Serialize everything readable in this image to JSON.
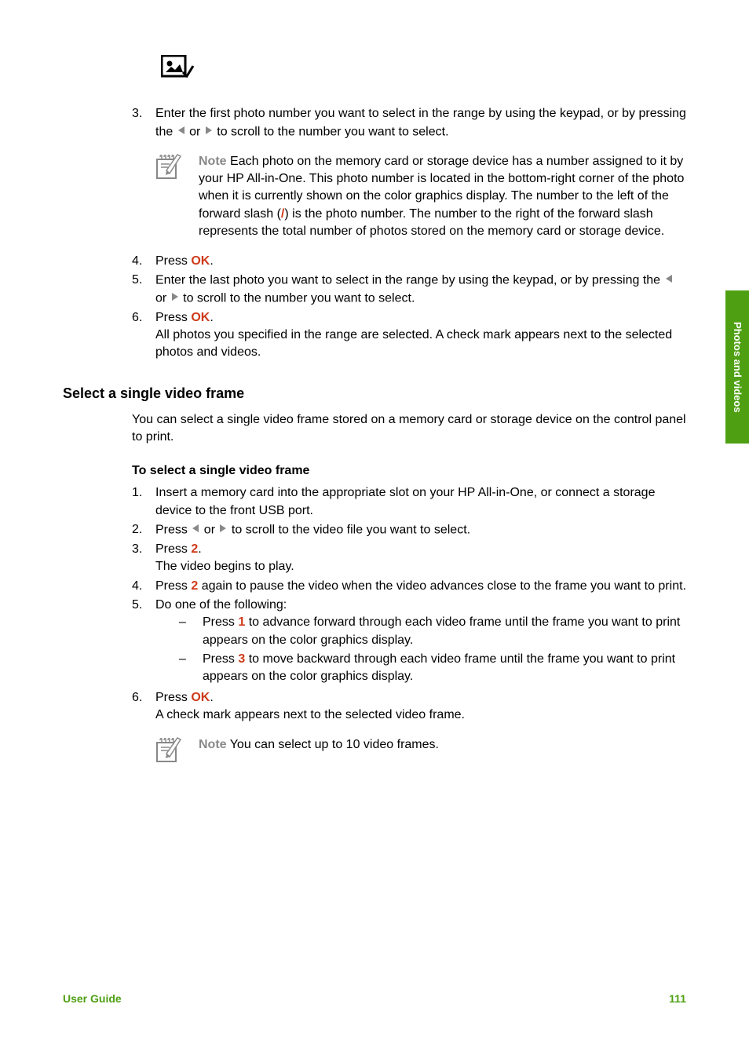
{
  "sideTab": "Photos and videos",
  "step3": {
    "num": "3.",
    "textA": "Enter the first photo number you want to select in the range by using the keypad, or by pressing the ",
    "textB": " or ",
    "textC": " to scroll to the number you want to select."
  },
  "note1": {
    "label": "Note",
    "textA": "Each photo on the memory card or storage device has a number assigned to it by your HP All-in-One. This photo number is located in the bottom-right corner of the photo when it is currently shown on the color graphics display. The number to the left of the forward slash (",
    "slash": "/",
    "textB": ") is the photo number. The number to the right of the forward slash represents the total number of photos stored on the memory card or storage device."
  },
  "step4": {
    "num": "4.",
    "textA": "Press ",
    "ok": "OK",
    "textB": "."
  },
  "step5": {
    "num": "5.",
    "textA": "Enter the last photo you want to select in the range by using the keypad, or by pressing the ",
    "textB": " or ",
    "textC": " to scroll to the number you want to select."
  },
  "step6": {
    "num": "6.",
    "textA": "Press ",
    "ok": "OK",
    "textB": ".",
    "body": "All photos you specified in the range are selected. A check mark appears next to the selected photos and videos."
  },
  "sectionHeading": "Select a single video frame",
  "sectionPara": "You can select a single video frame stored on a memory card or storage device on the control panel to print.",
  "subHeading": "To select a single video frame",
  "vstep1": {
    "num": "1.",
    "text": "Insert a memory card into the appropriate slot on your HP All-in-One, or connect a storage device to the front USB port."
  },
  "vstep2": {
    "num": "2.",
    "textA": "Press ",
    "textB": " or ",
    "textC": " to scroll to the video file you want to select."
  },
  "vstep3": {
    "num": "3.",
    "textA": "Press ",
    "key": "2",
    "textB": ".",
    "body": "The video begins to play."
  },
  "vstep4": {
    "num": "4.",
    "textA": "Press ",
    "key": "2",
    "textB": " again to pause the video when the video advances close to the frame you want to print."
  },
  "vstep5": {
    "num": "5.",
    "text": "Do one of the following:",
    "sub1a": "Press ",
    "sub1key": "1",
    "sub1b": " to advance forward through each video frame until the frame you want to print appears on the color graphics display.",
    "sub2a": "Press ",
    "sub2key": "3",
    "sub2b": " to move backward through each video frame until the frame you want to print appears on the color graphics display."
  },
  "vstep6": {
    "num": "6.",
    "textA": "Press ",
    "ok": "OK",
    "textB": ".",
    "body": "A check mark appears next to the selected video frame."
  },
  "note2": {
    "label": "Note",
    "text": "You can select up to 10 video frames."
  },
  "footer": {
    "left": "User Guide",
    "right": "111"
  }
}
